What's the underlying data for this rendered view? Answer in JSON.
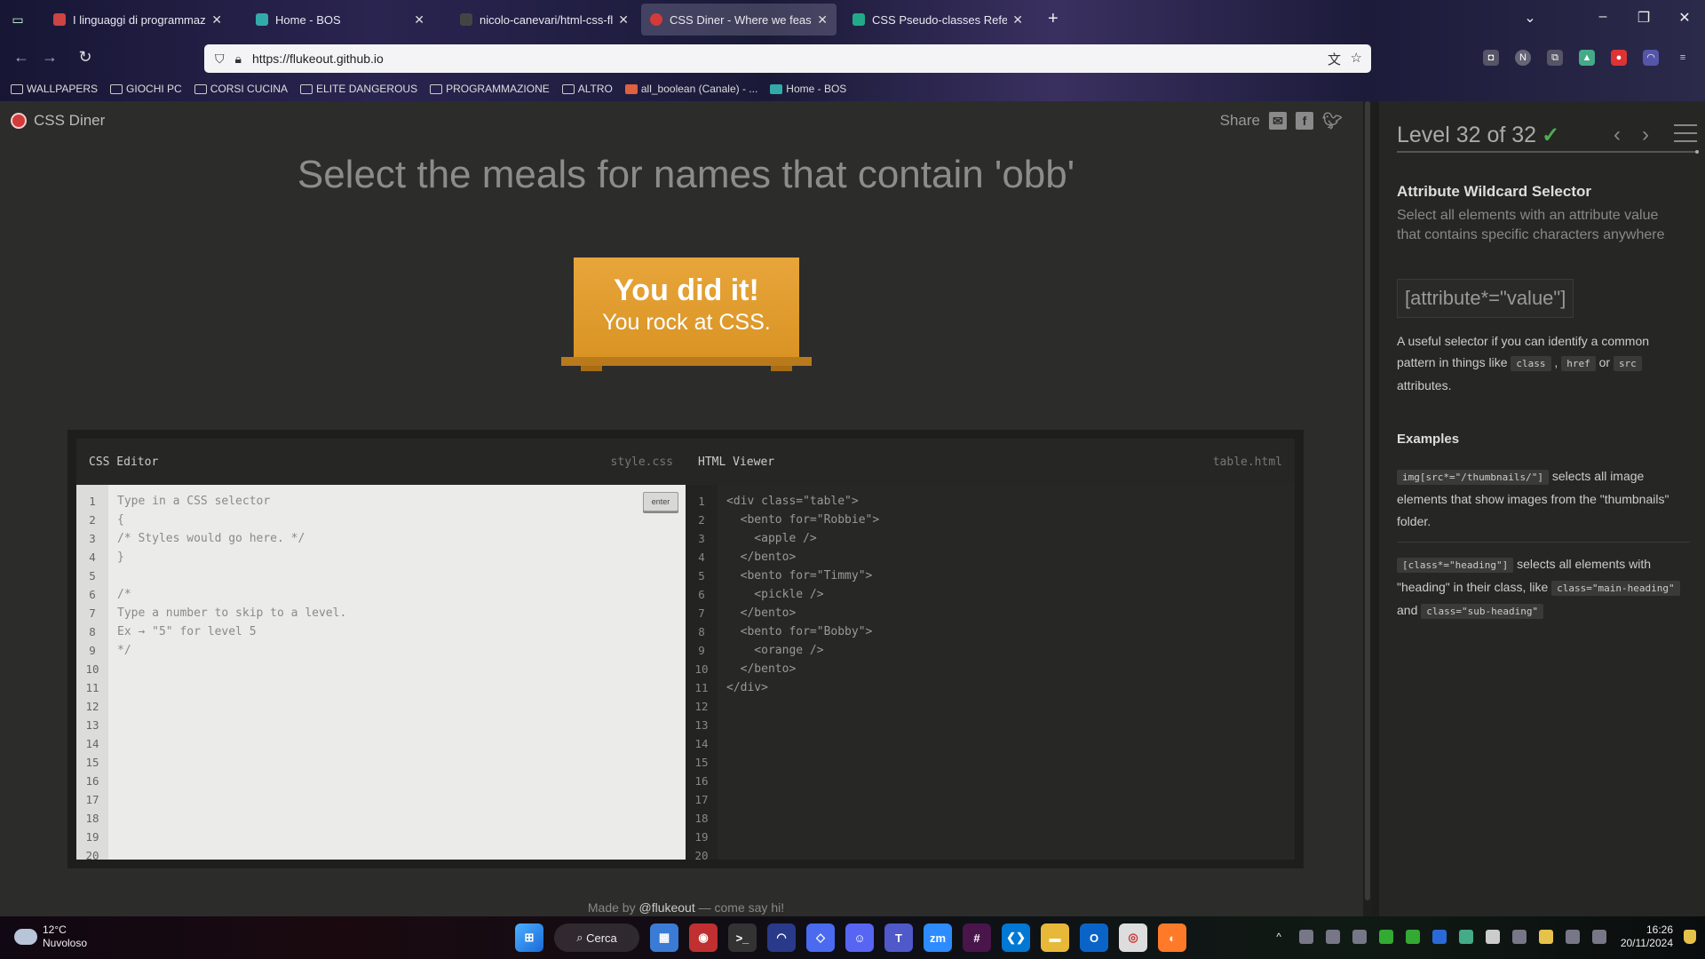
{
  "browser": {
    "tabs": [
      {
        "label": "I linguaggi di programmazion",
        "favicon_color": "#c44",
        "active": false
      },
      {
        "label": "Home - BOS",
        "favicon_color": "#3aa",
        "active": false
      },
      {
        "label": "nicolo-canevari/html-css-fluke",
        "favicon_color": "#444",
        "active": false
      },
      {
        "label": "CSS Diner - Where we feast on",
        "favicon_color": "#d33a3a",
        "active": true
      },
      {
        "label": "CSS Pseudo-classes Reference",
        "favicon_color": "#2a8",
        "active": false
      }
    ],
    "url": "https://flukeout.github.io",
    "bookmarks": [
      {
        "label": "WALLPAPERS",
        "icon": "folder-icon"
      },
      {
        "label": "GIOCHI PC",
        "icon": "folder-icon"
      },
      {
        "label": "CORSI CUCINA",
        "icon": "folder-icon"
      },
      {
        "label": "ELITE DANGEROUS",
        "icon": "folder-icon"
      },
      {
        "label": "PROGRAMMAZIONE",
        "icon": "folder-icon"
      },
      {
        "label": "ALTRO",
        "icon": "folder-icon"
      },
      {
        "label": "all_boolean (Canale) - ...",
        "icon": "slack-icon"
      },
      {
        "label": "Home - BOS",
        "icon": "bos-icon"
      }
    ]
  },
  "app": {
    "logo_text": "CSS Diner",
    "share_label": "Share",
    "order_text": "Select the meals for names that contain 'obb'",
    "win_title": "You did it!",
    "win_sub": "You rock at CSS.",
    "footer_prefix": "Made by ",
    "footer_link": "@flukeout",
    "footer_suffix": " — come say hi!"
  },
  "css_editor": {
    "title": "CSS Editor",
    "filename": "style.css",
    "enter_label": "enter",
    "line_numbers": [
      "1",
      "2",
      "3",
      "4",
      "5",
      "6",
      "7",
      "8",
      "9",
      "10",
      "11",
      "12",
      "13",
      "14",
      "15",
      "16",
      "17",
      "18",
      "19",
      "20"
    ],
    "lines": [
      "Type in a CSS selector",
      "{",
      "/* Styles would go here. */",
      "}",
      "",
      "/*",
      "Type a number to skip to a level.",
      "Ex → \"5\" for level 5",
      "*/"
    ]
  },
  "html_viewer": {
    "title": "HTML Viewer",
    "filename": "table.html",
    "line_numbers": [
      "1",
      "2",
      "3",
      "4",
      "5",
      "6",
      "7",
      "8",
      "9",
      "10",
      "11",
      "12",
      "13",
      "14",
      "15",
      "16",
      "17",
      "18",
      "19",
      "20"
    ],
    "lines": [
      "<div class=\"table\">",
      "  <bento for=\"Robbie\">",
      "    <apple />",
      "  </bento>",
      "  <bento for=\"Timmy\">",
      "    <pickle />",
      "  </bento>",
      "  <bento for=\"Bobby\">",
      "    <orange />",
      "  </bento>",
      "</div>"
    ]
  },
  "sidebar": {
    "level_text": "Level 32 of 32",
    "check": "✓",
    "selector_name": "Attribute Wildcard Selector",
    "description": "Select all elements with an attribute value that contains specific characters anywhere",
    "syntax": "[attribute*=\"value\"]",
    "hint_pre": "A useful selector if you can identify a common pattern in things like ",
    "hint_tag1": "class",
    "hint_mid1": " , ",
    "hint_tag2": "href",
    "hint_mid2": " or ",
    "hint_tag3": "src",
    "hint_post": " attributes.",
    "examples_title": "Examples",
    "ex1_code": "img[src*=\"/thumbnails/\"]",
    "ex1_text": " selects all image elements that show images from the \"thumbnails\" folder.",
    "ex2_code": "[class*=\"heading\"]",
    "ex2_text1": " selects all elements with \"heading\" in their class, like ",
    "ex2_code2": "class=\"main-heading\"",
    "ex2_text2": " and ",
    "ex2_code3": "class=\"sub-heading\""
  },
  "taskbar": {
    "temp": "12°C",
    "weather": "Nuvoloso",
    "search_label": "Cerca",
    "time": "16:26",
    "date": "20/11/2024"
  }
}
